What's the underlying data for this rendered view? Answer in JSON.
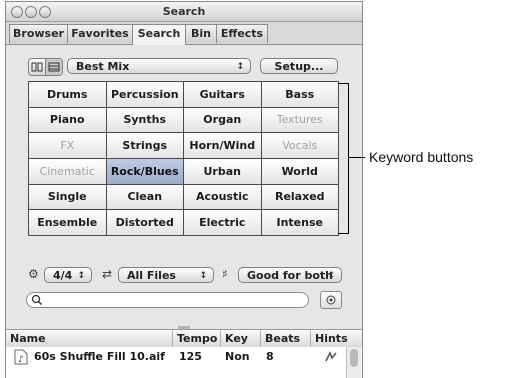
{
  "window": {
    "title": "Search"
  },
  "tabs": [
    "Browser",
    "Favorites",
    "Search",
    "Bin",
    "Effects"
  ],
  "active_tab": "Search",
  "toolbar": {
    "preset_value": "Best Mix",
    "setup_label": "Setup..."
  },
  "keywords": [
    [
      {
        "label": "Drums",
        "state": "normal"
      },
      {
        "label": "Percussion",
        "state": "normal"
      },
      {
        "label": "Guitars",
        "state": "normal"
      },
      {
        "label": "Bass",
        "state": "normal"
      }
    ],
    [
      {
        "label": "Piano",
        "state": "normal"
      },
      {
        "label": "Synths",
        "state": "normal"
      },
      {
        "label": "Organ",
        "state": "normal"
      },
      {
        "label": "Textures",
        "state": "disabled"
      }
    ],
    [
      {
        "label": "FX",
        "state": "disabled"
      },
      {
        "label": "Strings",
        "state": "normal"
      },
      {
        "label": "Horn/Wind",
        "state": "normal"
      },
      {
        "label": "Vocals",
        "state": "disabled"
      }
    ],
    [
      {
        "label": "Cinematic",
        "state": "disabled"
      },
      {
        "label": "Rock/Blues",
        "state": "selected"
      },
      {
        "label": "Urban",
        "state": "normal"
      },
      {
        "label": "World",
        "state": "normal"
      }
    ],
    [
      {
        "label": "Single",
        "state": "normal"
      },
      {
        "label": "Clean",
        "state": "normal"
      },
      {
        "label": "Acoustic",
        "state": "normal"
      },
      {
        "label": "Relaxed",
        "state": "normal"
      }
    ],
    [
      {
        "label": "Ensemble",
        "state": "normal"
      },
      {
        "label": "Distorted",
        "state": "normal"
      },
      {
        "label": "Electric",
        "state": "normal"
      },
      {
        "label": "Intense",
        "state": "normal"
      }
    ]
  ],
  "callout": {
    "text": "Keyword buttons"
  },
  "filters": {
    "signature": "4/4",
    "file_type": "All Files",
    "key_match": "Good for both"
  },
  "search": {
    "value": ""
  },
  "table": {
    "columns": [
      "Name",
      "Tempo",
      "Key",
      "Beats",
      "Hints"
    ],
    "rows": [
      {
        "name": "60s Shuffle Fill 10.aif",
        "tempo": "125",
        "key": "Non",
        "beats": "8"
      }
    ]
  },
  "colors": {
    "selected_button": "#a9b8d2",
    "disabled_text": "#a2a2a2",
    "window_bg": "#e6e6e6"
  }
}
